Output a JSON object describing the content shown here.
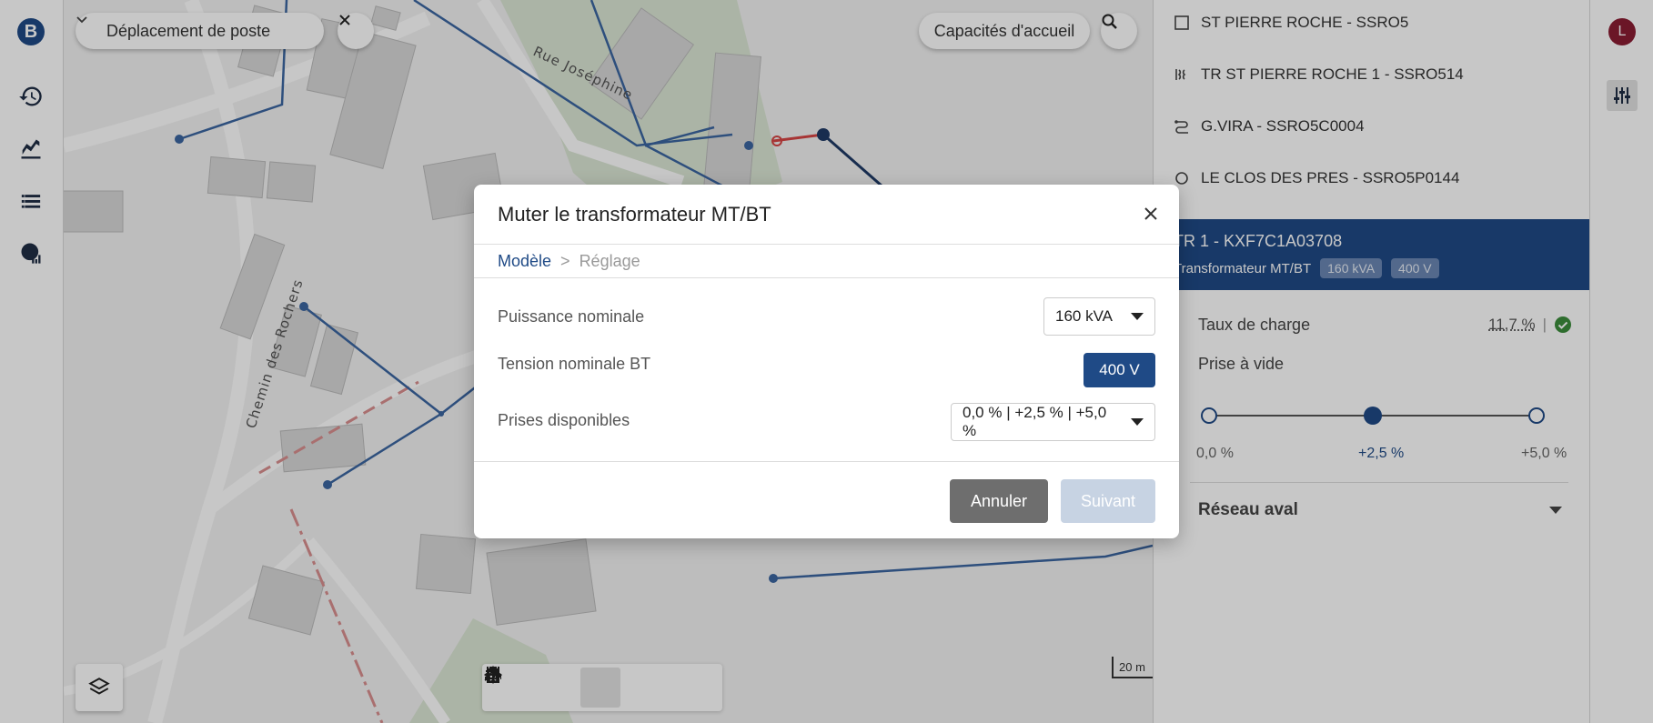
{
  "app": {
    "logo_letter": "B",
    "user_initial": "L"
  },
  "map": {
    "station_select": "Déplacement de poste",
    "capacity_button": "Capacités d'accueil",
    "street_labels": [
      "Rue Joséphine",
      "Chemin des Rochers"
    ],
    "scale_label": "20 m",
    "info_label": "i"
  },
  "panel": {
    "items": [
      {
        "label": "ST PIERRE ROCHE - SSRO5",
        "icon": "square-icon"
      },
      {
        "label": "TR ST PIERRE ROCHE 1 - SSRO514",
        "icon": "transformer-icon"
      },
      {
        "label": "G.VIRA - SSRO5C0004",
        "icon": "route-icon"
      },
      {
        "label": "LE CLOS DES PRES - SSRO5P0144",
        "icon": "circle-icon"
      }
    ],
    "selected": {
      "title": "TR 1 - KXF7C1A03708",
      "type": "Transformateur MT/BT",
      "power_chip": "160 kVA",
      "voltage_chip": "400 V"
    },
    "load_label": "Taux de charge",
    "load_value": "11,7 %",
    "tap_label": "Prise à vide",
    "tap_options": [
      "0,0 %",
      "+2,5 %",
      "+5,0 %"
    ],
    "tap_selected_index": 1,
    "downstream_label": "Réseau aval"
  },
  "modal": {
    "title": "Muter le transformateur MT/BT",
    "breadcrumb": {
      "step1": "Modèle",
      "sep": ">",
      "step2": "Réglage"
    },
    "rows": {
      "power_label": "Puissance nominale",
      "power_value": "160 kVA",
      "voltage_label": "Tension nominale BT",
      "voltage_value": "400 V",
      "taps_label": "Prises disponibles",
      "taps_value": "0,0 % | +2,5 % | +5,0 %"
    },
    "cancel_label": "Annuler",
    "next_label": "Suivant"
  },
  "colors": {
    "brand": "#1f4a86",
    "network_line": "#3b66a0",
    "alert_line": "#d64545",
    "ok_green": "#3c8c3c",
    "avatar": "#8a1d33"
  }
}
